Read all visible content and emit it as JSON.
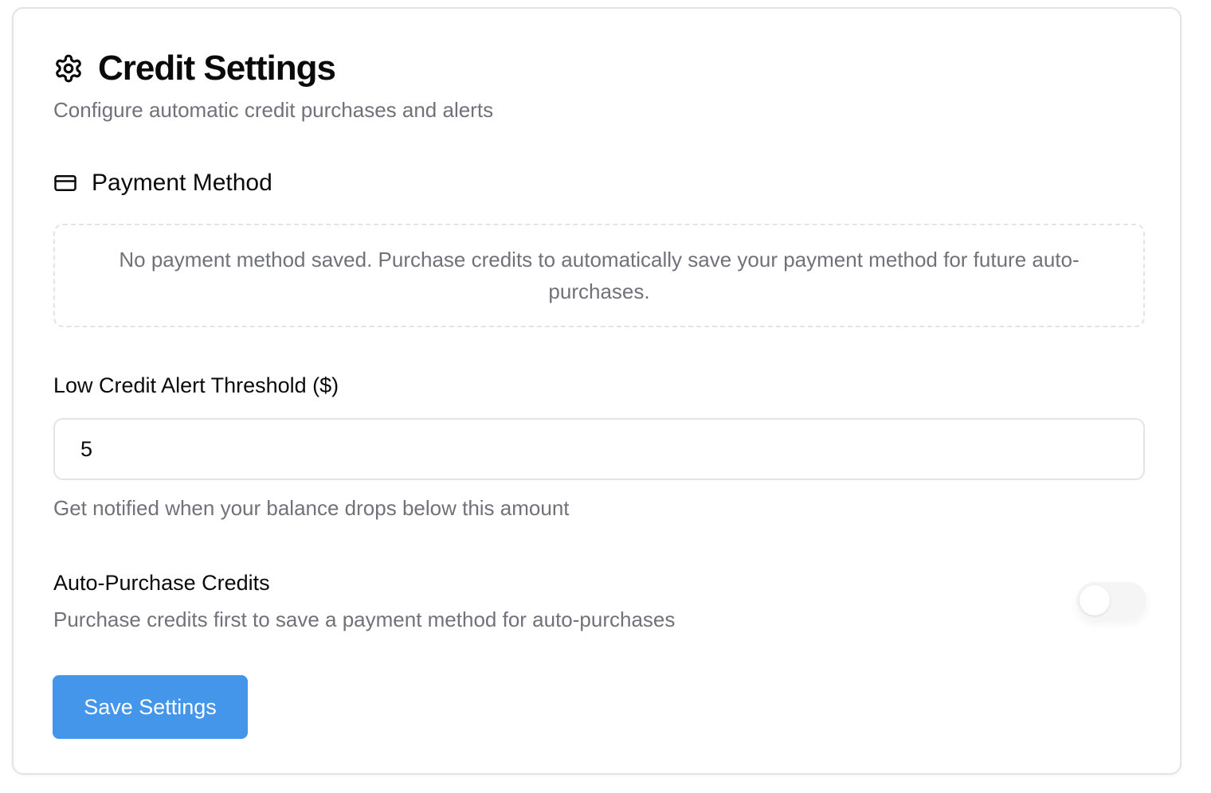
{
  "header": {
    "title": "Credit Settings",
    "subtitle": "Configure automatic credit purchases and alerts",
    "icon": "gear-icon"
  },
  "payment_method": {
    "title": "Payment Method",
    "icon": "credit-card-icon",
    "empty_message": "No payment method saved. Purchase credits to automatically save your payment method for future auto-purchases."
  },
  "threshold": {
    "label": "Low Credit Alert Threshold ($)",
    "value": "5",
    "help": "Get notified when your balance drops below this amount"
  },
  "auto_purchase": {
    "label": "Auto-Purchase Credits",
    "description": "Purchase credits first to save a payment method for auto-purchases",
    "enabled": false
  },
  "actions": {
    "save_label": "Save Settings"
  },
  "colors": {
    "accent": "#4496ea",
    "muted_text": "#71717a",
    "border": "#e4e4e7"
  }
}
